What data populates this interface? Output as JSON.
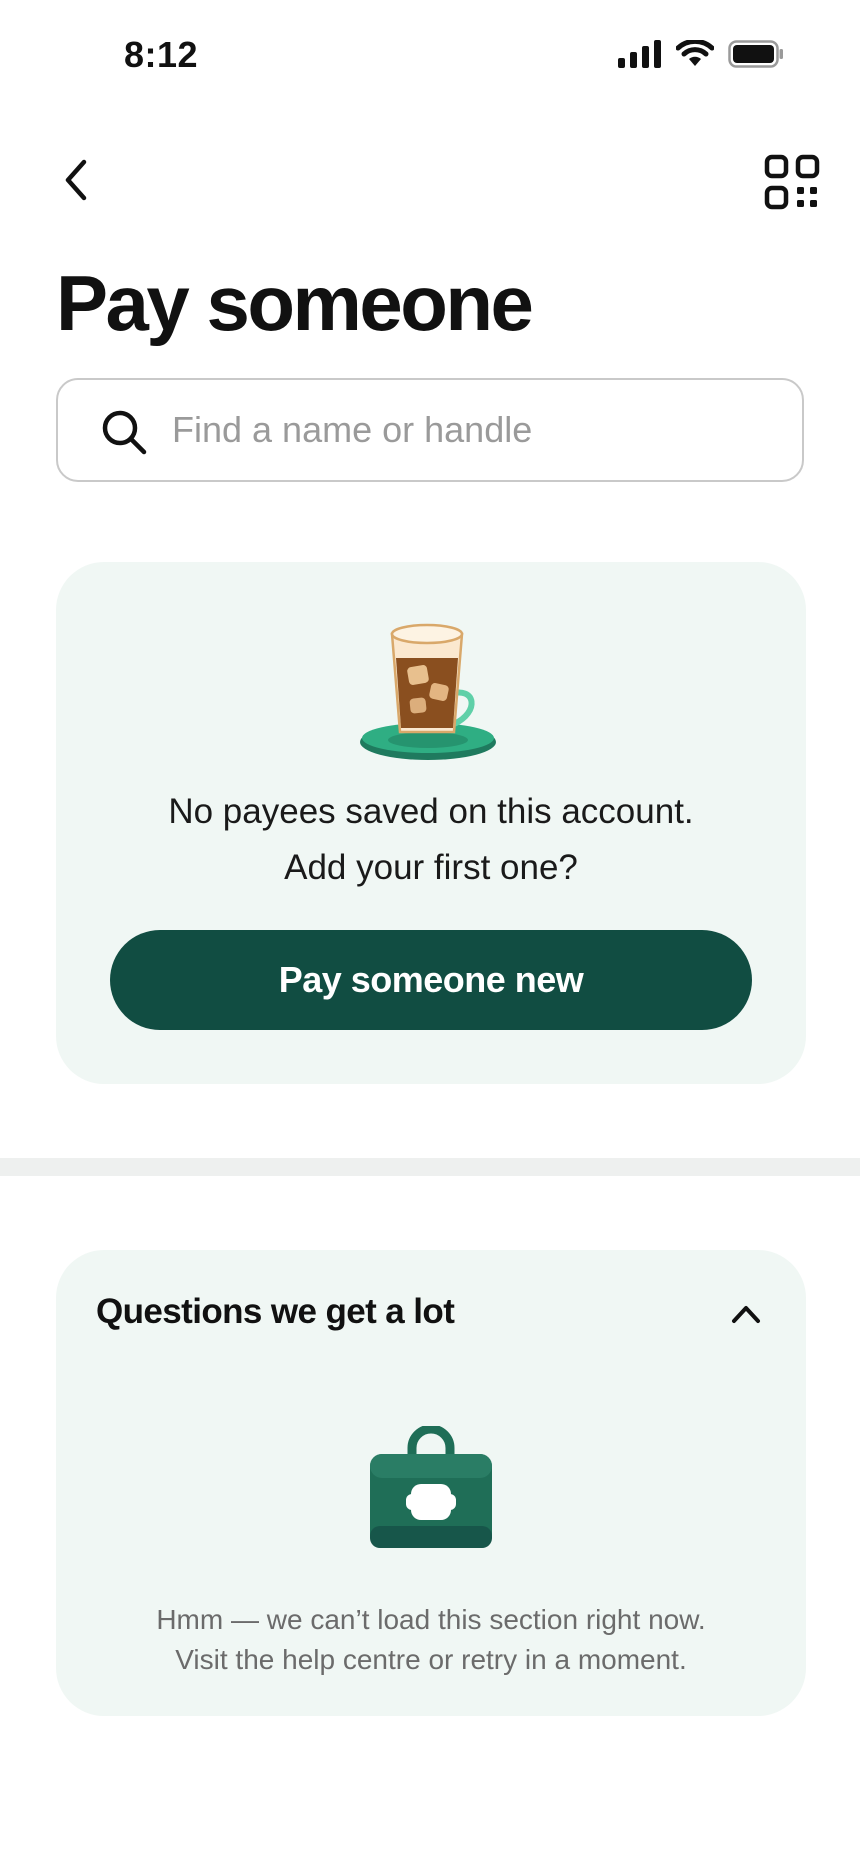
{
  "status_bar": {
    "time": "8:12"
  },
  "nav": {
    "back_icon": "chevron-left-icon",
    "qr_icon": "qr-code-icon"
  },
  "page": {
    "title": "Pay someone"
  },
  "search": {
    "placeholder": "Find a name or handle",
    "value": "",
    "icon": "search-icon"
  },
  "payees": {
    "illustration": "iced-coffee-illustration",
    "empty_line1": "No payees saved on this account.",
    "empty_line2": "Add your first one?",
    "button_label": "Pay someone new",
    "button_color": "#114d42",
    "card_color": "#f0f7f4"
  },
  "faq": {
    "title": "Questions we get a lot",
    "expanded": true,
    "illustration": "briefcase-illustration",
    "error_line1": "Hmm — we can’t load this section right now.",
    "error_line2": "Visit the help centre or retry in a moment."
  }
}
